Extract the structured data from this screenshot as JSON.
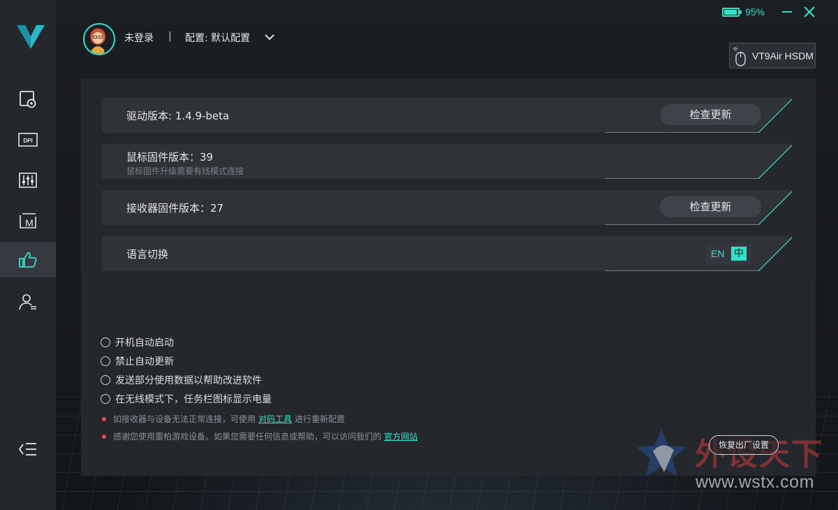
{
  "colors": {
    "accent": "#35e0c8",
    "sidebar_bg": "#24272c",
    "panel_bg": "#24272c",
    "warning_dot": "#e84d4d"
  },
  "topbar": {
    "battery_level": 0.95,
    "battery_text": "95%",
    "minimize_icon": "minimize-icon",
    "close_icon": "close-icon"
  },
  "sidebar": {
    "logo": "brand-logo-v",
    "items": [
      {
        "icon": "screen-settings-icon",
        "active": false
      },
      {
        "icon": "dpi-icon",
        "active": false
      },
      {
        "icon": "sliders-icon",
        "active": false
      },
      {
        "icon": "macro-icon",
        "active": false
      },
      {
        "icon": "thumbs-up-icon",
        "active": true
      },
      {
        "icon": "user-profile-icon",
        "active": false
      }
    ],
    "collapse_icon": "collapse-menu-icon"
  },
  "header": {
    "login_status": "未登录",
    "separator": "|",
    "config_label": "配置: 默认配置",
    "device_name": "VT9Air HSDM"
  },
  "rows": {
    "driver": {
      "title": "驱动版本: 1.4.9-beta",
      "button": "检查更新"
    },
    "mouse_fw": {
      "title": "鼠标固件版本：39",
      "sub": "鼠标固件升级需要有线模式连接"
    },
    "receiver_fw": {
      "title": "接收器固件版本：27",
      "button": "检查更新"
    },
    "language": {
      "title": "语言切换",
      "en": "EN",
      "zh": "中",
      "selected": "zh"
    }
  },
  "options": [
    {
      "label": "开机自动启动",
      "checked": false
    },
    {
      "label": "禁止自动更新",
      "checked": false
    },
    {
      "label": "发送部分使用数据以帮助改进软件",
      "checked": false
    },
    {
      "label": "在无线模式下，任务栏图标显示电量",
      "checked": false
    }
  ],
  "notes": {
    "pair": {
      "before": "如接收器与设备无法正常连接，可使用",
      "link": "对码工具",
      "after": "进行重新配置"
    },
    "thanks": {
      "before": "感谢您使用雷柏游戏设备。如果您需要任何信息或帮助，可以访问我们的",
      "link": "官方网站"
    }
  },
  "reset_button": "恢复出厂设置",
  "watermark": {
    "text": "外设天下",
    "url": "www.wstx.com"
  }
}
